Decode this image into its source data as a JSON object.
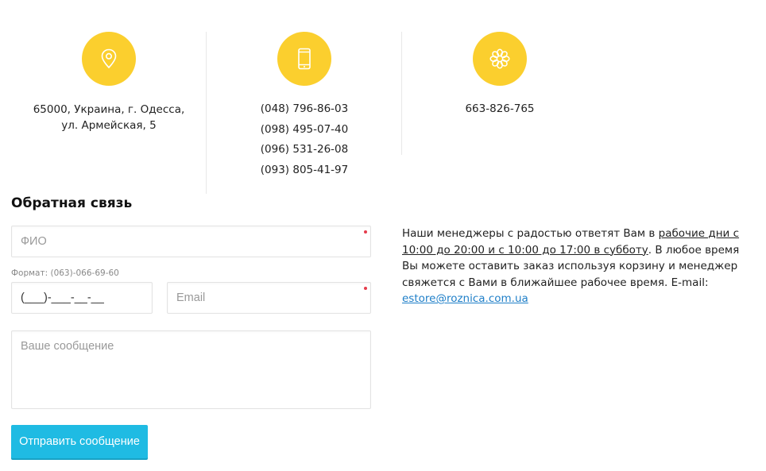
{
  "contacts": {
    "address": {
      "line1": "65000, Украина, г. Одесса,",
      "line2": "ул. Армейская, 5"
    },
    "phones": [
      "(048) 796-86-03",
      "(098) 495-07-40",
      "(096) 531-26-08",
      "(093) 805-41-97"
    ],
    "icq": "663-826-765"
  },
  "icons": {
    "address": "location-pin-icon",
    "phones": "mobile-phone-icon",
    "icq": "icq-flower-icon",
    "circle_color": "#fbcf2e"
  },
  "form": {
    "title": "Обратная связь",
    "fio_placeholder": "ФИО",
    "phone_format_hint": "Формат: (063)-066-69-60",
    "phone_value": "(___)-___-__-__",
    "email_placeholder": "Email",
    "message_placeholder": "Ваше сообщение",
    "submit_label": "Отправить сообщение",
    "submit_color": "#1fbbe3",
    "required_color": "#e53c4c"
  },
  "info": {
    "text1": "Наши менеджеры с радостью ответят Вам в ",
    "hours": "рабочие дни с 10:00 до 20:00 и с 10:00 до 17:00 в субботу",
    "text2": ". В любое время Вы можете оставить заказ используя корзину и менеджер свяжется с Вами в ближайшее рабочее время. E-mail: ",
    "email": "estore@roznica.com.ua",
    "link_color": "#1f7fc8"
  }
}
